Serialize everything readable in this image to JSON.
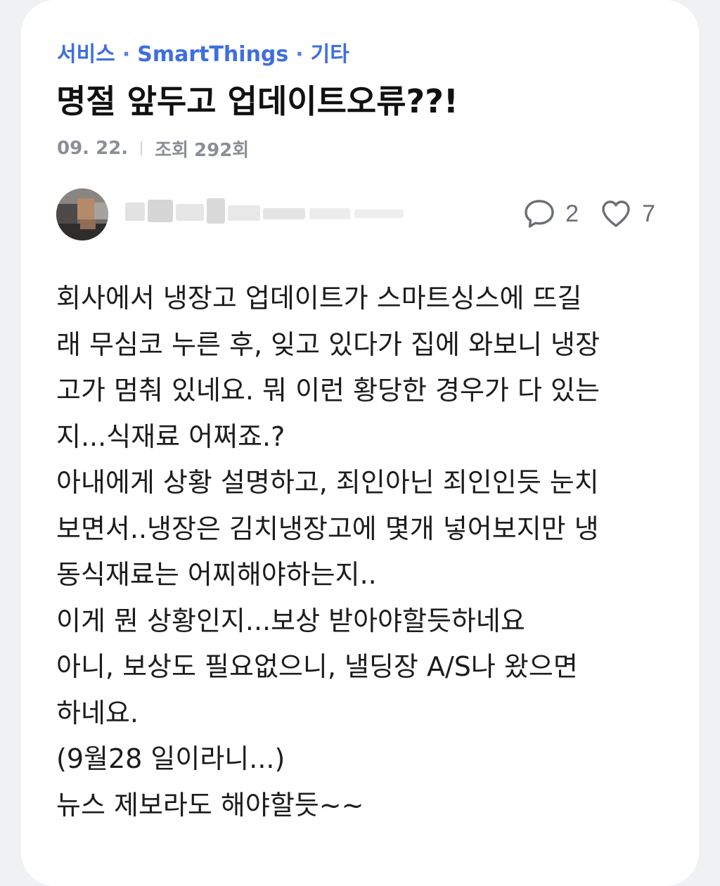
{
  "breadcrumb": {
    "items": [
      "서비스",
      "SmartThings",
      "기타"
    ],
    "separator": "·"
  },
  "post": {
    "title": "명절 앞두고 업데이트오류??!",
    "date": "09. 22.",
    "views_label": "조회",
    "views_count": "292회",
    "comment_count": "2",
    "like_count": "7",
    "body_lines": [
      "회사에서 냉장고 업데이트가 스마트싱스에 뜨길",
      "래 무심코 누른 후, 잊고 있다가 집에 와보니 냉장",
      "고가 멈춰 있네요. 뭐 이런 황당한 경우가 다 있는",
      "지...식재료 어쩌죠.?",
      "아내에게 상황 설명하고, 죄인아닌 죄인인듯 눈치",
      "보면서..냉장은 김치냉장고에 몇개 넣어보지만 냉",
      "동식재료는 어찌해야하는지..",
      "이게 뭔 상황인지...보상 받아야할듯하네요",
      "아니, 보상도 필요없으니, 낼딩장 A/S나 왔으면",
      "하네요.",
      "(9월28 일이라니...)",
      "뉴스 제보라도 해야할듯~~"
    ]
  },
  "icons": {
    "comment": "speech-bubble-icon",
    "like": "heart-outline-icon"
  },
  "colors": {
    "accent": "#3e6ee0",
    "meta_text": "#8b8f95",
    "body_text": "#1c1c1c",
    "card_bg": "#ffffff",
    "page_bg": "#f0f1f3"
  }
}
